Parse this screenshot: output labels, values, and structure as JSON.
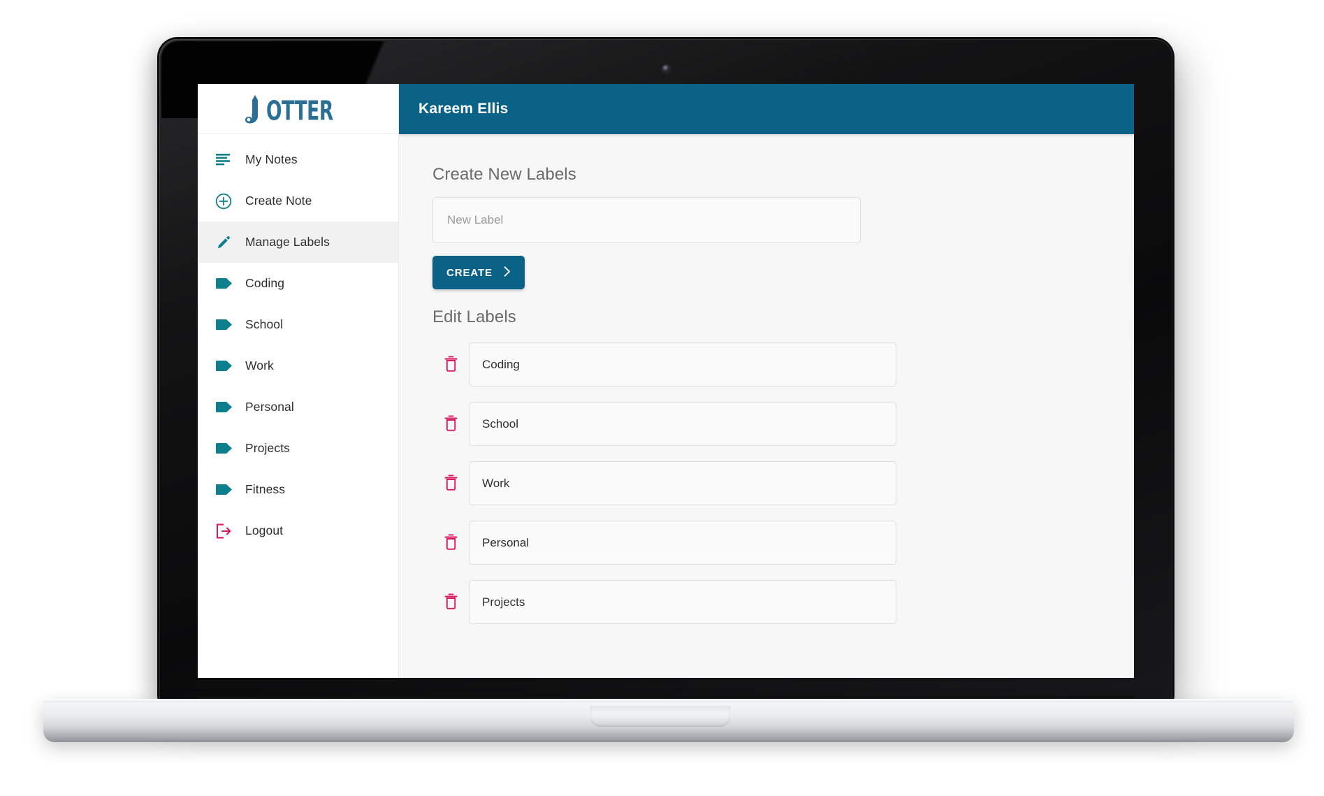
{
  "brand": {
    "logo_text_lead": "J",
    "logo_text_rest": "OTTER",
    "logo_color": "#2b6f96"
  },
  "topbar": {
    "user_name": "Kareem Ellis",
    "background_color": "#0a6287",
    "text_color": "#ffffff"
  },
  "sidebar": {
    "accent_color": "#0e7f8c",
    "logout_color": "#d1court",
    "items": [
      {
        "label": "My Notes",
        "icon": "notes-lines-icon",
        "active": false
      },
      {
        "label": "Create Note",
        "icon": "plus-circle-icon",
        "active": false
      },
      {
        "label": "Manage Labels",
        "icon": "pencil-icon",
        "active": true
      },
      {
        "label": "Coding",
        "icon": "tag-icon",
        "active": false
      },
      {
        "label": "School",
        "icon": "tag-icon",
        "active": false
      },
      {
        "label": "Work",
        "icon": "tag-icon",
        "active": false
      },
      {
        "label": "Personal",
        "icon": "tag-icon",
        "active": false
      },
      {
        "label": "Projects",
        "icon": "tag-icon",
        "active": false
      },
      {
        "label": "Fitness",
        "icon": "tag-icon",
        "active": false
      },
      {
        "label": "Logout",
        "icon": "logout-icon",
        "active": false
      }
    ]
  },
  "main": {
    "create_section": {
      "title": "Create New Labels",
      "input_value": "",
      "input_placeholder": "New Label",
      "button_label": "CREATE",
      "button_chevron": "chevron-right-icon",
      "button_color": "#0b6287"
    },
    "edit_section": {
      "title": "Edit Labels",
      "delete_icon": "trash-icon",
      "delete_icon_color": "#d81b60",
      "rows": [
        {
          "value": "Coding"
        },
        {
          "value": "School"
        },
        {
          "value": "Work"
        },
        {
          "value": "Personal"
        },
        {
          "value": "Projects"
        }
      ]
    }
  },
  "device": {
    "type": "laptop-mockup",
    "webcam": "webcam-dot"
  }
}
